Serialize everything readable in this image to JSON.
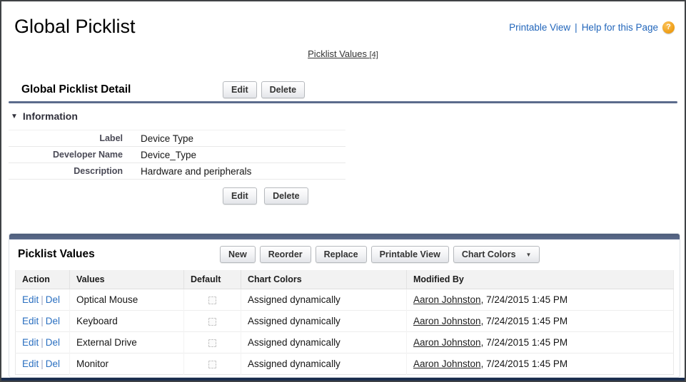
{
  "page": {
    "title": "Global Picklist"
  },
  "header": {
    "printable_view": "Printable View",
    "separator": "|",
    "help_link": "Help for this Page",
    "help_icon_glyph": "?"
  },
  "jump_link": {
    "label": "Picklist Values",
    "count": "[4]"
  },
  "detail_section": {
    "title": "Global Picklist Detail",
    "buttons": [
      "Edit",
      "Delete"
    ],
    "information": {
      "header": "Information",
      "collapse_icon": "▼",
      "fields": [
        {
          "label": "Label",
          "value": "Device Type"
        },
        {
          "label": "Developer Name",
          "value": "Device_Type"
        },
        {
          "label": "Description",
          "value": "Hardware and peripherals"
        }
      ]
    }
  },
  "values_section": {
    "title": "Picklist Values",
    "buttons": [
      "New",
      "Reorder",
      "Replace",
      "Printable View"
    ],
    "dropdown_button": {
      "label": "Chart Colors",
      "arrow_icon": "▼"
    },
    "table": {
      "headers": [
        "Action",
        "Values",
        "Default",
        "Chart Colors",
        "Modified By"
      ],
      "action_links": [
        "Edit",
        "Del"
      ],
      "action_separator": "|",
      "rows": [
        {
          "value": "Optical Mouse",
          "default_checked": false,
          "chart_colors": "Assigned dynamically",
          "modified_by_user": "Aaron Johnston",
          "modified_rest": ", 7/24/2015 1:45 PM"
        },
        {
          "value": "Keyboard",
          "default_checked": false,
          "chart_colors": "Assigned dynamically",
          "modified_by_user": "Aaron Johnston",
          "modified_rest": ", 7/24/2015 1:45 PM"
        },
        {
          "value": "External Drive",
          "default_checked": false,
          "chart_colors": "Assigned dynamically",
          "modified_by_user": "Aaron Johnston",
          "modified_rest": ", 7/24/2015 1:45 PM"
        },
        {
          "value": "Monitor",
          "default_checked": false,
          "chart_colors": "Assigned dynamically",
          "modified_by_user": "Aaron Johnston",
          "modified_rest": ", 7/24/2015 1:45 PM"
        }
      ]
    }
  },
  "colors": {
    "section_bar": "#5b6b8c",
    "link_blue": "#2a6fc0",
    "help_icon_orange": "#ee9d14",
    "bottom_bar": "#1a2d4e"
  }
}
